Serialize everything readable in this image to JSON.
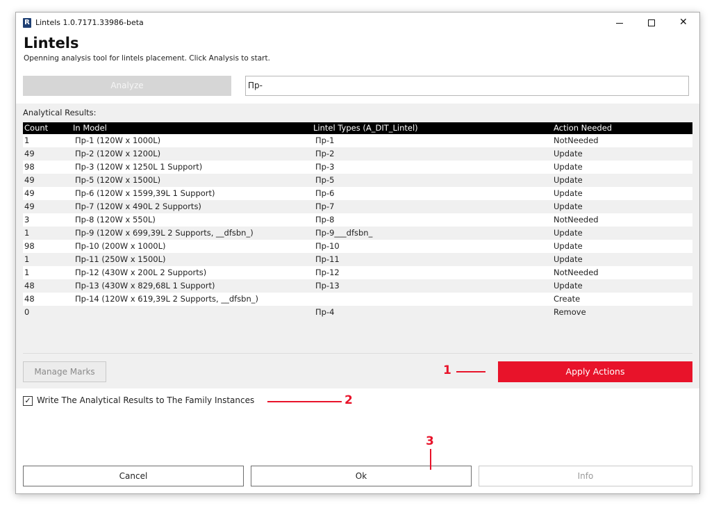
{
  "window": {
    "title": "Lintels 1.0.7171.33986-beta",
    "app_icon_letter": "R",
    "close_glyph": "✕"
  },
  "header": {
    "title": "Lintels",
    "subtitle": "Openning analysis tool for lintels placement. Click Analysis to start."
  },
  "toolbar": {
    "analyze_label": "Analyze",
    "filter_value": "Пр-"
  },
  "results": {
    "label": "Analytical Results:",
    "columns": [
      "Count",
      "In Model",
      "Lintel Types (A_DIT_Lintel)",
      "Action Needed"
    ],
    "rows": [
      [
        "1",
        "Пр-1 (120W x 1000L)",
        "Пр-1",
        "NotNeeded"
      ],
      [
        "49",
        "Пр-2 (120W x 1200L)",
        "Пр-2",
        "Update"
      ],
      [
        "98",
        "Пр-3 (120W x 1250L 1 Support)",
        "Пр-3",
        "Update"
      ],
      [
        "49",
        "Пр-5 (120W x 1500L)",
        "Пр-5",
        "Update"
      ],
      [
        "49",
        "Пр-6 (120W x 1599,39L 1 Support)",
        "Пр-6",
        "Update"
      ],
      [
        "49",
        "Пр-7 (120W x 490L 2 Supports)",
        "Пр-7",
        "Update"
      ],
      [
        "3",
        "Пр-8 (120W x 550L)",
        "Пр-8",
        "NotNeeded"
      ],
      [
        "1",
        "Пр-9 (120W x 699,39L 2 Supports, __dfsbn_)",
        "Пр-9___dfsbn_",
        "Update"
      ],
      [
        "98",
        "Пр-10 (200W x 1000L)",
        "Пр-10",
        "Update"
      ],
      [
        "1",
        "Пр-11 (250W x 1500L)",
        "Пр-11",
        "Update"
      ],
      [
        "1",
        "Пр-12 (430W x 200L 2 Supports)",
        "Пр-12",
        "NotNeeded"
      ],
      [
        "48",
        "Пр-13 (430W x 829,68L 1 Support)",
        "Пр-13",
        "Update"
      ],
      [
        "48",
        "Пр-14 (120W x 619,39L 2 Supports, __dfsbn_)",
        "",
        "Create"
      ],
      [
        "0",
        "",
        "Пр-4",
        "Remove"
      ]
    ],
    "manage_marks_label": "Manage Marks",
    "apply_label": "Apply Actions"
  },
  "options": {
    "write_results_label": "Write The Analytical Results to The Family Instances",
    "write_results_checked": true,
    "check_glyph": "✓"
  },
  "footer": {
    "cancel_label": "Cancel",
    "ok_label": "Ok",
    "info_label": "Info"
  },
  "annotations": [
    "1",
    "2",
    "3"
  ],
  "colors": {
    "accent_red": "#e8132a",
    "header_black": "#000000",
    "panel_gray": "#f0f0f0"
  }
}
